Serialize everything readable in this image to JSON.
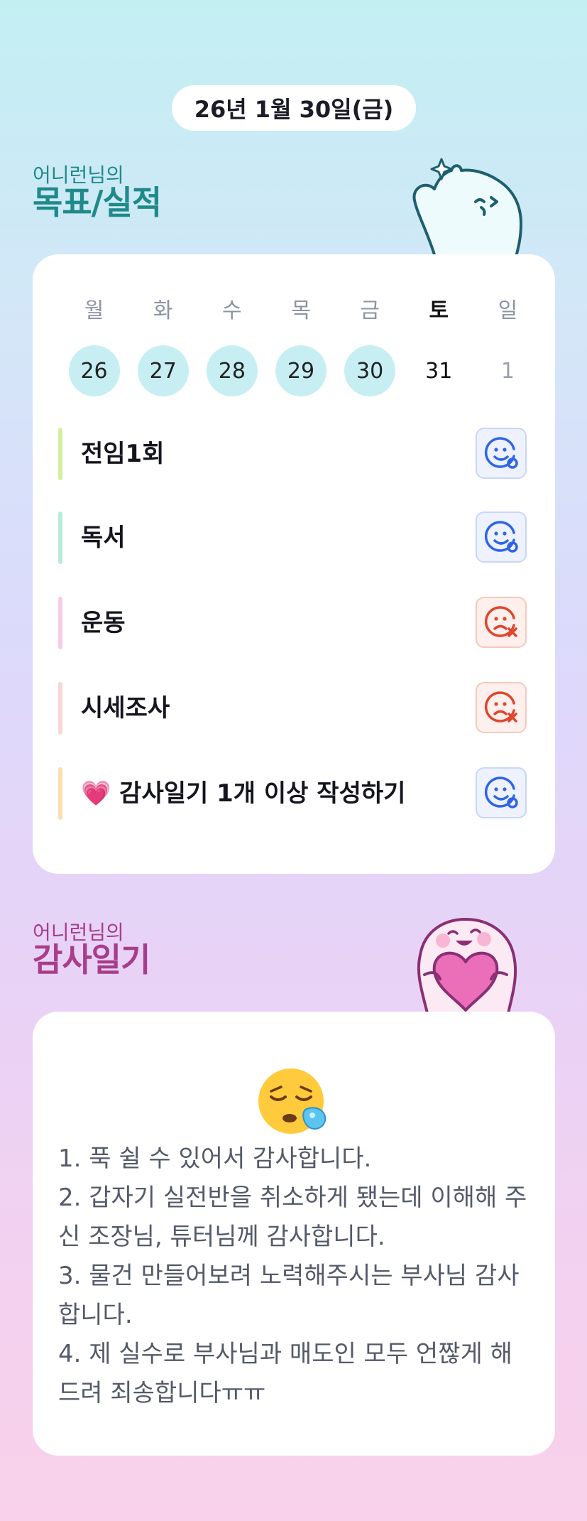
{
  "header": {
    "date": "26년 1월 30일(금)"
  },
  "goals_section": {
    "owner": "어니런님의",
    "title": "목표/실적",
    "week": [
      {
        "dow": "월",
        "date": "26",
        "state": "done"
      },
      {
        "dow": "화",
        "date": "27",
        "state": "done"
      },
      {
        "dow": "수",
        "date": "28",
        "state": "done"
      },
      {
        "dow": "목",
        "date": "29",
        "state": "done"
      },
      {
        "dow": "금",
        "date": "30",
        "state": "done"
      },
      {
        "dow": "토",
        "date": "31",
        "state": "today"
      },
      {
        "dow": "일",
        "date": "1",
        "state": "future"
      }
    ],
    "goals": [
      {
        "label": "전임1회",
        "status": "smile-check-icon",
        "bar_color": "#d5eda0"
      },
      {
        "label": "독서",
        "status": "smile-check-icon",
        "bar_color": "#b7ecd9"
      },
      {
        "label": "운동",
        "status": "sad-x-icon",
        "bar_color": "#f6cde9"
      },
      {
        "label": "시세조사",
        "status": "sad-x-icon",
        "bar_color": "#fad6d6"
      },
      {
        "label": "💗 감사일기 1개 이상 작성하기",
        "status": "smile-check-icon",
        "bar_color": "#fbdfae"
      }
    ]
  },
  "gratitude_section": {
    "owner": "어니런님의",
    "title": "감사일기",
    "mood_icon": "sleepy-face-icon",
    "entries": [
      "1. 푹 쉴 수 있어서 감사합니다.",
      "2. 갑자기 실전반을 취소하게 됐는데 이해해 주신 조장님, 튜터님께 감사합니다.",
      "3. 물건 만들어보려 노력해주시는 부사님 감사합니다.",
      "4. 제 실수로 부사님과 매도인 모두 언짢게 해드려 죄송합니다ㅠㅠ"
    ]
  },
  "colors": {
    "goal_title": "#1f8a8a",
    "gratitude_title": "#a83d8a",
    "done_circle": "#c7eff3",
    "success_icon": "#2f64e8",
    "fail_icon": "#e0452e"
  }
}
